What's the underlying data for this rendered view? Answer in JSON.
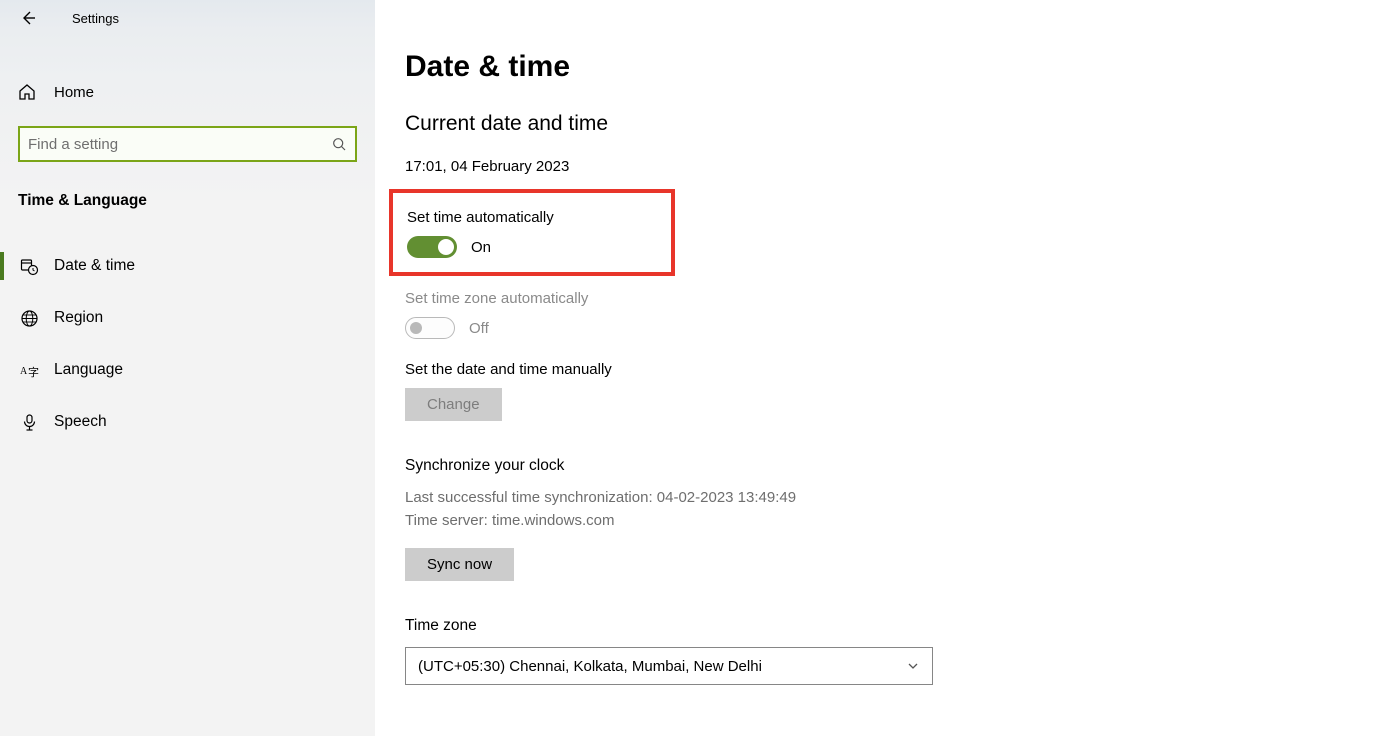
{
  "app_title": "Settings",
  "home_label": "Home",
  "search_placeholder": "Find a setting",
  "category_title": "Time & Language",
  "nav": [
    {
      "id": "date-time",
      "label": "Date & time",
      "active": true
    },
    {
      "id": "region",
      "label": "Region",
      "active": false
    },
    {
      "id": "language",
      "label": "Language",
      "active": false
    },
    {
      "id": "speech",
      "label": "Speech",
      "active": false
    }
  ],
  "page_title": "Date & time",
  "current_heading": "Current date and time",
  "current_datetime": "17:01, 04 February 2023",
  "set_time_auto": {
    "label": "Set time automatically",
    "on": true,
    "state_text": "On"
  },
  "set_tz_auto": {
    "label": "Set time zone automatically",
    "on": false,
    "state_text": "Off",
    "disabled": true
  },
  "set_manual": {
    "label": "Set the date and time manually",
    "button": "Change",
    "button_disabled": true
  },
  "sync": {
    "heading": "Synchronize your clock",
    "last_sync": "Last successful time synchronization: 04-02-2023 13:49:49",
    "server": "Time server: time.windows.com",
    "button": "Sync now"
  },
  "timezone": {
    "label": "Time zone",
    "selected": "(UTC+05:30) Chennai, Kolkata, Mumbai, New Delhi"
  }
}
